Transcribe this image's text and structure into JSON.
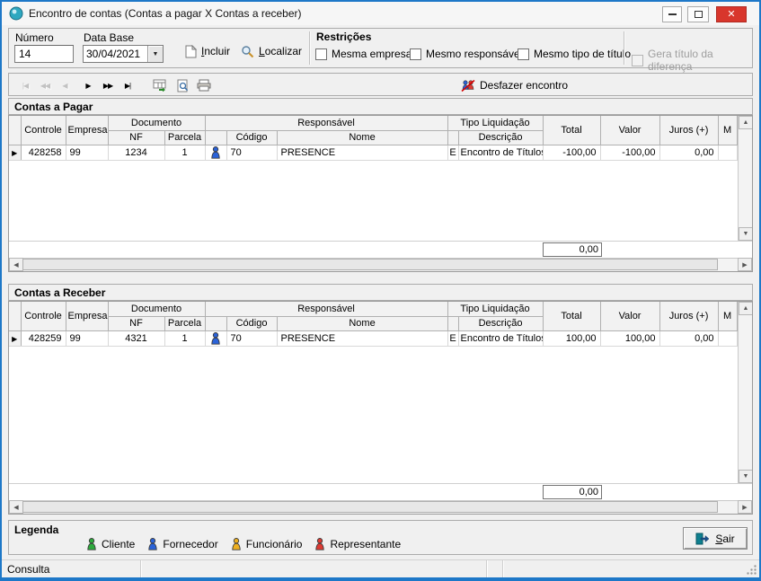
{
  "window": {
    "title": "Encontro de contas (Contas a pagar X Contas a receber)"
  },
  "toolbar": {
    "numero": {
      "label": "Número",
      "value": "14"
    },
    "data_base": {
      "label": "Data Base",
      "value": "30/04/2021"
    },
    "incluir_label": "Incluir",
    "localizar_label": "Localizar",
    "restricoes": {
      "label": "Restrições",
      "options": [
        {
          "label": "Mesma empresa",
          "checked": false
        },
        {
          "label": "Mesmo responsável",
          "checked": false
        },
        {
          "label": "Mesmo tipo de título",
          "checked": false
        }
      ]
    },
    "gera_titulo": {
      "label": "Gera título da diferença",
      "enabled": false,
      "checked": false
    }
  },
  "navbar": {
    "buttons": [
      {
        "glyph": "|◀",
        "enabled": false
      },
      {
        "glyph": "◀◀",
        "enabled": false
      },
      {
        "glyph": "◀",
        "enabled": false
      },
      {
        "glyph": "▶",
        "enabled": true
      },
      {
        "glyph": "▶▶",
        "enabled": true
      },
      {
        "glyph": "▶|",
        "enabled": true
      }
    ],
    "desfazer_label": "Desfazer encontro"
  },
  "grid_headers": {
    "controle": "Controle",
    "empresa": "Empresa",
    "documento": "Documento",
    "nf": "NF",
    "parcela": "Parcela",
    "responsavel": "Responsável",
    "codigo": "Código",
    "nome": "Nome",
    "tipo_liquidacao": "Tipo Liquidação",
    "descricao": "Descrição",
    "total": "Total",
    "valor": "Valor",
    "juros": "Juros (+)",
    "multa": "M"
  },
  "contas_pagar": {
    "title": "Contas a Pagar",
    "rows": [
      {
        "controle": "428258",
        "empresa": "99",
        "nf": "1234",
        "parcela": "1",
        "codigo": "70",
        "nome": "PRESENCE",
        "tipo": "E",
        "descricao": "Encontro de Títulos",
        "total": "-100,00",
        "valor": "-100,00",
        "juros": "0,00"
      }
    ],
    "footer_total": "0,00"
  },
  "contas_receber": {
    "title": "Contas a Receber",
    "rows": [
      {
        "controle": "428259",
        "empresa": "99",
        "nf": "4321",
        "parcela": "1",
        "codigo": "70",
        "nome": "PRESENCE",
        "tipo": "E",
        "descricao": "Encontro de Títulos",
        "total": "100,00",
        "valor": "100,00",
        "juros": "0,00"
      }
    ],
    "footer_total": "0,00"
  },
  "legend": {
    "title": "Legenda",
    "items": [
      {
        "label": "Cliente",
        "color": "#2daa3c"
      },
      {
        "label": "Fornecedor",
        "color": "#2a62d8"
      },
      {
        "label": "Funcionário",
        "color": "#eeb020"
      },
      {
        "label": "Representante",
        "color": "#dd3a33"
      }
    ]
  },
  "sair_label": "Sair",
  "statusbar": {
    "mode": "Consulta"
  }
}
